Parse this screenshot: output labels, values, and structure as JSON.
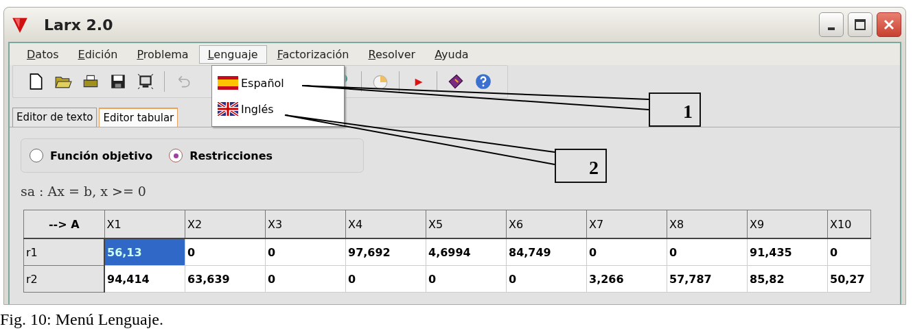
{
  "window": {
    "title": "Larx 2.0"
  },
  "menu": [
    {
      "label": "Datos",
      "selected": false
    },
    {
      "label": "Edición",
      "selected": false
    },
    {
      "label": "Problema",
      "selected": false
    },
    {
      "label": "Lenguaje",
      "selected": true
    },
    {
      "label": "Factorización",
      "selected": false
    },
    {
      "label": "Resolver",
      "selected": false
    },
    {
      "label": "Ayuda",
      "selected": false
    }
  ],
  "dropdown": [
    {
      "label": "Español",
      "kind": "spain"
    },
    {
      "label": "Inglés",
      "kind": "britain"
    }
  ],
  "tabs": [
    {
      "label": "Editor de texto",
      "selected": false
    },
    {
      "label": "Editor tabular",
      "selected": true
    }
  ],
  "radios": [
    {
      "label": "Función objetivo",
      "selected": false
    },
    {
      "label": "Restricciones",
      "selected": true
    }
  ],
  "formula": "sa : Ax = b, x >= 0",
  "table": {
    "columns": [
      "--> A",
      "X1",
      "X2",
      "X3",
      "X4",
      "X5",
      "X6",
      "X7",
      "X8",
      "X9",
      "X10"
    ],
    "rows": [
      {
        "cells": [
          {
            "text": "r1",
            "selected": false
          },
          {
            "text": "56,13",
            "selected": true
          },
          {
            "text": "0",
            "selected": false
          },
          {
            "text": "0",
            "selected": false
          },
          {
            "text": "97,692",
            "selected": false
          },
          {
            "text": "4,6994",
            "selected": false
          },
          {
            "text": "84,749",
            "selected": false
          },
          {
            "text": "0",
            "selected": false
          },
          {
            "text": "0",
            "selected": false
          },
          {
            "text": "91,435",
            "selected": false
          },
          {
            "text": "0",
            "selected": false
          }
        ]
      },
      {
        "cells": [
          {
            "text": "r2",
            "selected": false
          },
          {
            "text": "94,414",
            "selected": false
          },
          {
            "text": "63,639",
            "selected": false
          },
          {
            "text": "0",
            "selected": false
          },
          {
            "text": "0",
            "selected": false
          },
          {
            "text": "0",
            "selected": false
          },
          {
            "text": "0",
            "selected": false
          },
          {
            "text": "3,266",
            "selected": false
          },
          {
            "text": "57,787",
            "selected": false
          },
          {
            "text": "85,82",
            "selected": false
          },
          {
            "text": "50,27",
            "selected": false
          }
        ]
      }
    ]
  },
  "callouts": [
    {
      "label": "1"
    },
    {
      "label": "2"
    }
  ],
  "caption": "Fig. 10: Menú Lenguaje."
}
